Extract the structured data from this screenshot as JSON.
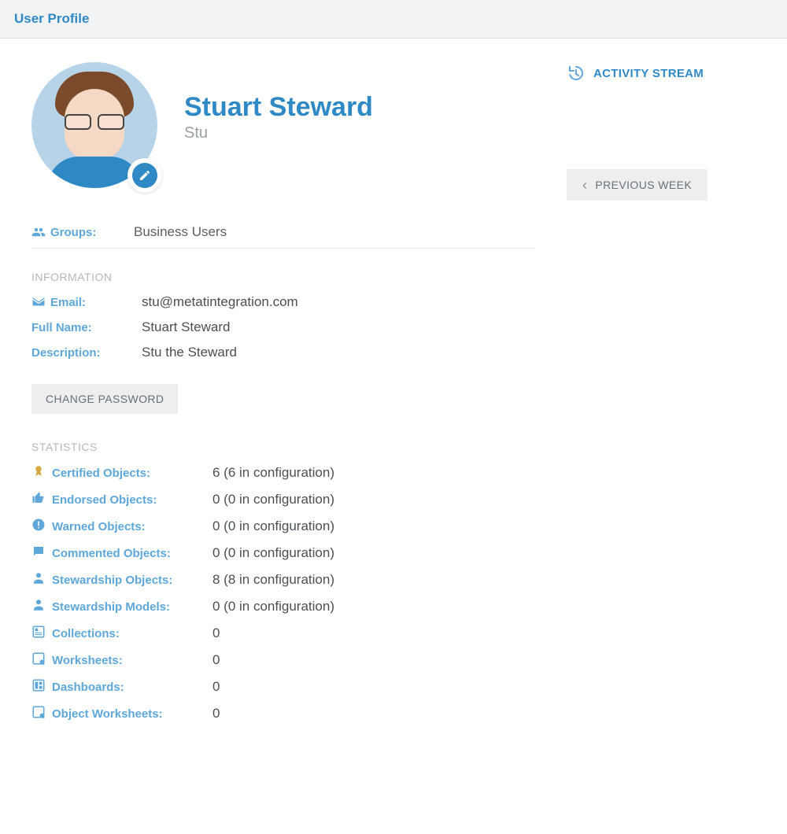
{
  "header": {
    "title": "User Profile"
  },
  "profile": {
    "displayName": "Stuart Steward",
    "nickname": "Stu"
  },
  "groups": {
    "label": "Groups:",
    "value": "Business Users"
  },
  "information": {
    "heading": "INFORMATION",
    "emailLabel": "Email:",
    "emailValue": "stu@metatintegration.com",
    "fullNameLabel": "Full Name:",
    "fullNameValue": "Stuart Steward",
    "descriptionLabel": "Description:",
    "descriptionValue": "Stu the Steward",
    "changePasswordLabel": "CHANGE PASSWORD"
  },
  "statistics": {
    "heading": "STATISTICS",
    "rows": [
      {
        "icon": "ribbon",
        "label": "Certified Objects:",
        "value": "6 (6 in configuration)"
      },
      {
        "icon": "thumb-up",
        "label": "Endorsed Objects:",
        "value": "0 (0 in configuration)"
      },
      {
        "icon": "warning",
        "label": "Warned Objects:",
        "value": "0 (0 in configuration)"
      },
      {
        "icon": "comment",
        "label": "Commented Objects:",
        "value": "0 (0 in configuration)"
      },
      {
        "icon": "person",
        "label": "Stewardship Objects:",
        "value": "8 (8 in configuration)"
      },
      {
        "icon": "person",
        "label": "Stewardship Models:",
        "value": "0 (0 in configuration)"
      },
      {
        "icon": "collection",
        "label": "Collections:",
        "value": "0"
      },
      {
        "icon": "worksheet",
        "label": "Worksheets:",
        "value": "0"
      },
      {
        "icon": "dashboard",
        "label": "Dashboards:",
        "value": "0"
      },
      {
        "icon": "worksheet",
        "label": "Object Worksheets:",
        "value": "0"
      }
    ]
  },
  "sidebar": {
    "activityStreamLabel": "ACTIVITY STREAM",
    "previousWeekLabel": "PREVIOUS WEEK"
  }
}
